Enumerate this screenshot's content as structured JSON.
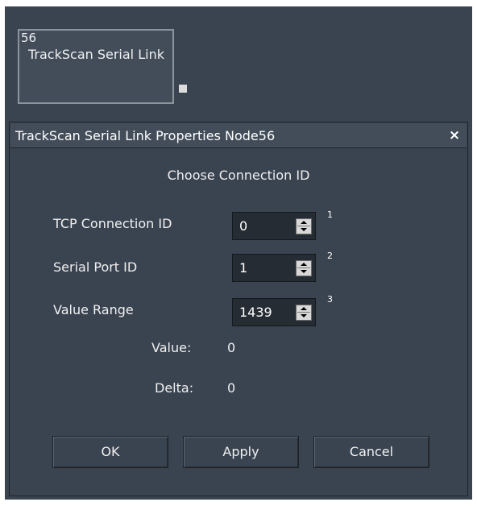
{
  "node": {
    "id": "56",
    "title": "TrackScan Serial Link"
  },
  "dialog": {
    "title": "TrackScan Serial Link Properties Node56",
    "close_label": "×",
    "heading": "Choose Connection ID",
    "fields": {
      "tcp_connection": {
        "label": "TCP Connection ID",
        "value": "0",
        "port_index": "1"
      },
      "serial_port": {
        "label": "Serial Port ID",
        "value": "1",
        "port_index": "2"
      },
      "value_range": {
        "label": "Value Range",
        "value": "1439",
        "port_index": "3"
      }
    },
    "readouts": {
      "value_label": "Value:",
      "value": "0",
      "delta_label": "Delta:",
      "delta": "0"
    },
    "buttons": {
      "ok": "OK",
      "apply": "Apply",
      "cancel": "Cancel"
    }
  }
}
